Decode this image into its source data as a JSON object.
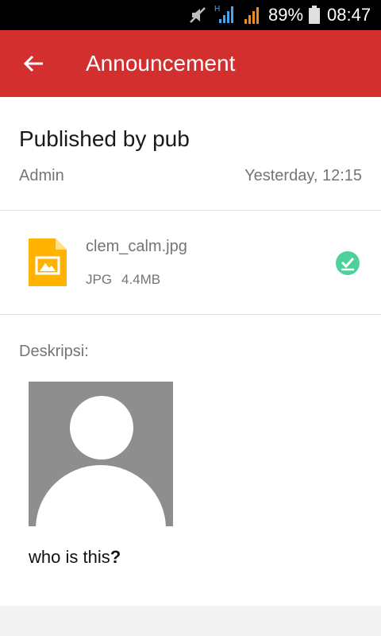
{
  "status_bar": {
    "battery_percent": "89%",
    "time": "08:47",
    "signal_label": "H",
    "icons": [
      "mute-icon",
      "signal-h-icon",
      "signal-icon",
      "battery-icon"
    ]
  },
  "app_bar": {
    "title": "Announcement",
    "color": "#d32f2f",
    "back_icon": "arrow-back-icon"
  },
  "announcement": {
    "title": "Published by pub",
    "author": "Admin",
    "date": "Yesterday, 12:15"
  },
  "attachment": {
    "file_name": "clem_calm.jpg",
    "file_type": "JPG",
    "file_size": "4.4MB",
    "icon": "image-file-icon",
    "status_icon": "downloaded-check-icon",
    "status_color": "#4cd19a",
    "icon_color": "#ffb300"
  },
  "description": {
    "label": "Deskripsi:",
    "text_main": "who is this",
    "text_bold": "?"
  }
}
